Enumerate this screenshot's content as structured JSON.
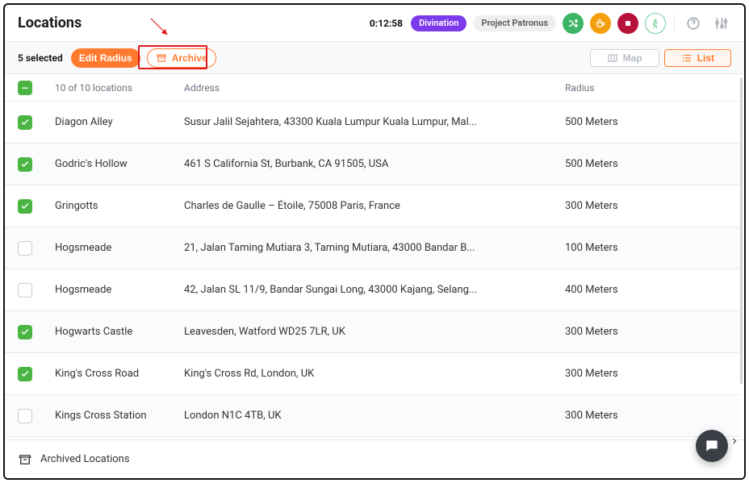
{
  "header": {
    "title": "Locations",
    "timer": "0:12:58",
    "tag_primary": "Divination",
    "tag_secondary": "Project Patronus"
  },
  "toolbar": {
    "selected_label": "5 selected",
    "edit_radius_label": "Edit Radius",
    "archive_label": "Archive",
    "map_label": "Map",
    "list_label": "List"
  },
  "columns": {
    "count": "10 of 10 locations",
    "address": "Address",
    "radius": "Radius"
  },
  "rows": [
    {
      "checked": true,
      "name": "Diagon Alley",
      "address": "Susur Jalil Sejahtera, 43300 Kuala Lumpur Kuala Lumpur, Mal...",
      "radius": "500 Meters"
    },
    {
      "checked": true,
      "name": "Godric's Hollow",
      "address": "461 S California St, Burbank, CA 91505, USA",
      "radius": "500 Meters"
    },
    {
      "checked": true,
      "name": "Gringotts",
      "address": "Charles de Gaulle – Étoile, 75008 Paris, France",
      "radius": "300 Meters"
    },
    {
      "checked": false,
      "name": "Hogsmeade",
      "address": "21, Jalan Taming Mutiara 3, Taming Mutiara, 43000 Bandar B...",
      "radius": "100 Meters"
    },
    {
      "checked": false,
      "name": "Hogsmeade",
      "address": "42, Jalan SL 11/9, Bandar Sungai Long, 43000 Kajang, Selang...",
      "radius": "400 Meters"
    },
    {
      "checked": true,
      "name": "Hogwarts Castle",
      "address": "Leavesden, Watford WD25 7LR, UK",
      "radius": "300 Meters"
    },
    {
      "checked": true,
      "name": "King's Cross Road",
      "address": "King's Cross Rd, London, UK",
      "radius": "300 Meters"
    },
    {
      "checked": false,
      "name": "Kings Cross Station",
      "address": "London N1C 4TB, UK",
      "radius": "300 Meters"
    }
  ],
  "footer": {
    "archived_label": "Archived Locations"
  }
}
